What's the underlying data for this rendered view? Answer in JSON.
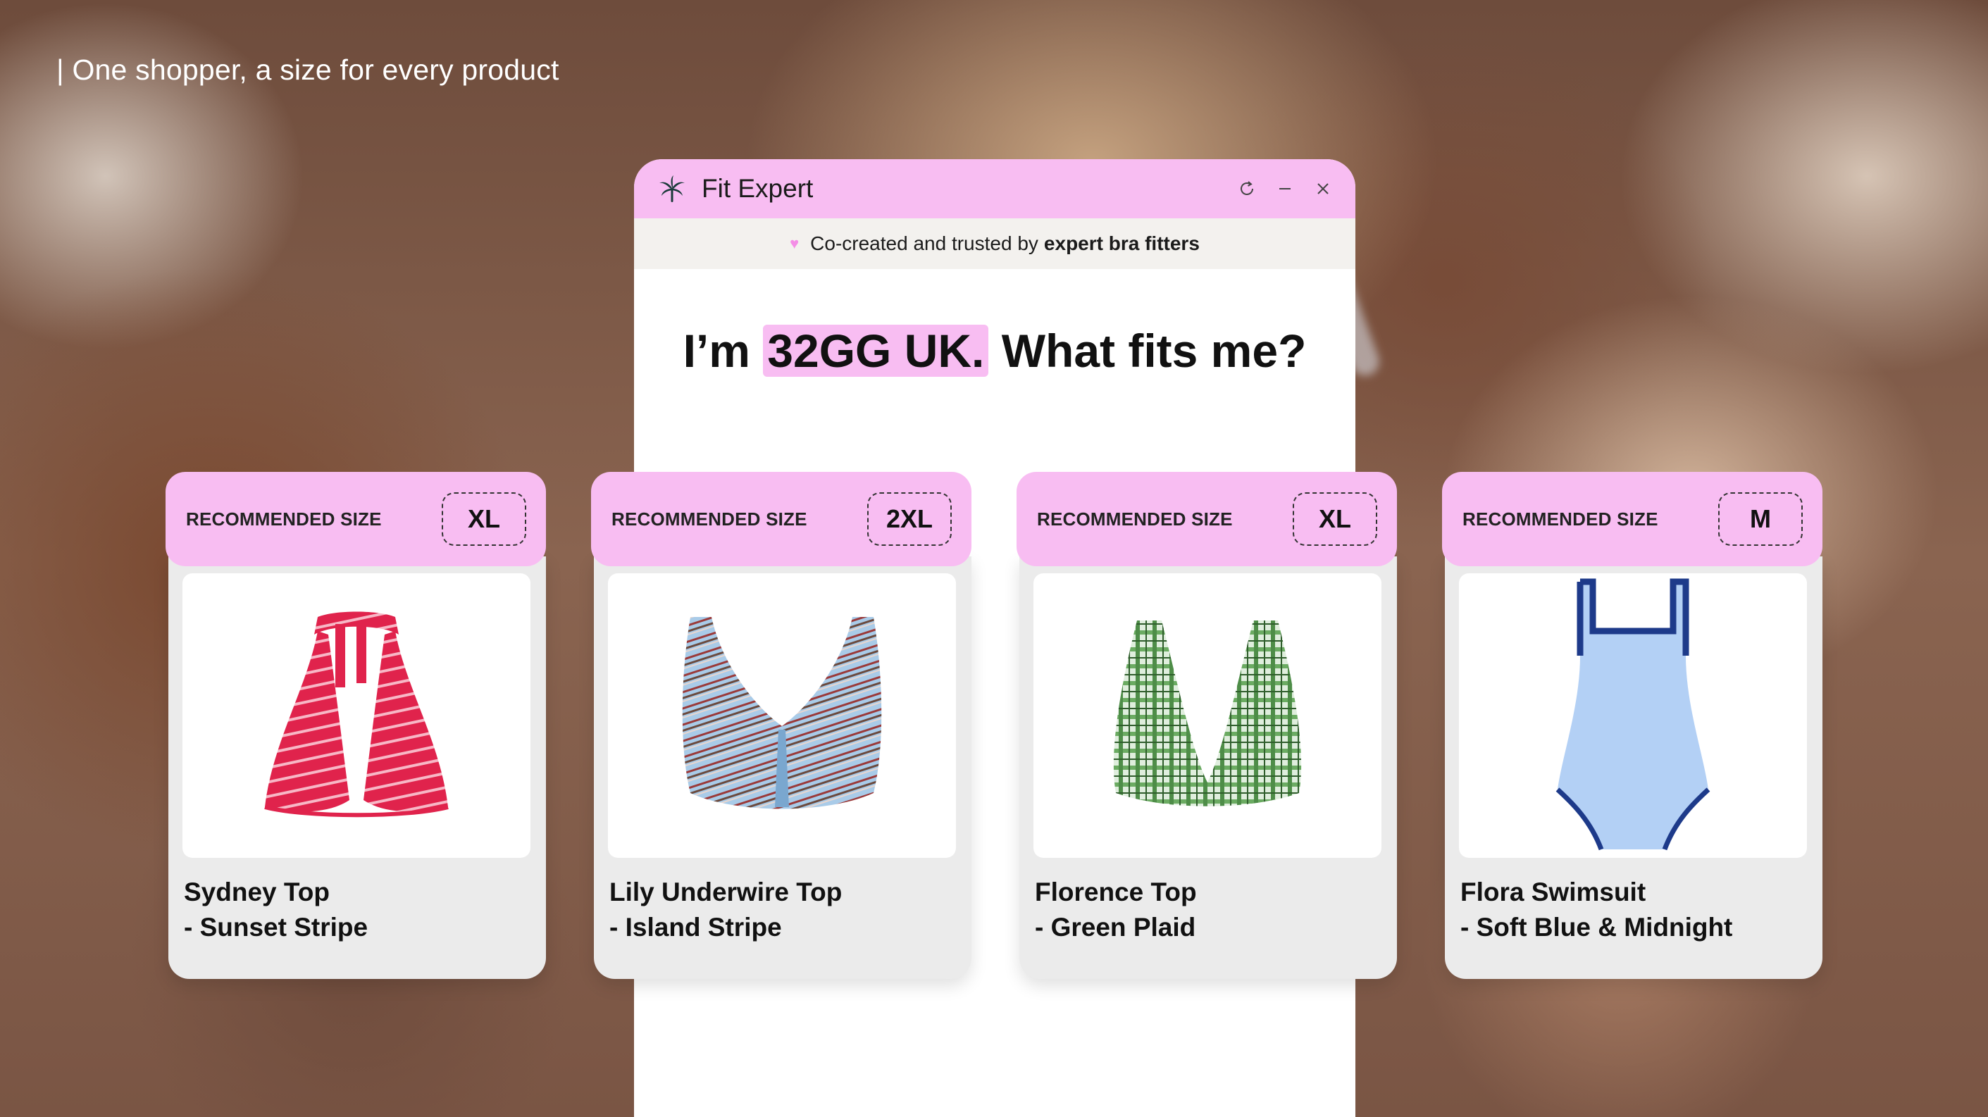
{
  "headline": "| One shopper, a size for every product",
  "widget": {
    "title": "Fit Expert",
    "banner_prefix": "Co-created and trusted by",
    "banner_bold": "expert bra fitters",
    "question_start": "I’m",
    "question_size": "32GG UK.",
    "question_end": "What fits me?"
  },
  "products": [
    {
      "rec_label": "RECOMMENDED SIZE",
      "size": "XL",
      "name_line1": "Sydney Top",
      "name_line2": "- Sunset Stripe"
    },
    {
      "rec_label": "RECOMMENDED SIZE",
      "size": "2XL",
      "name_line1": "Lily Underwire Top",
      "name_line2": "- Island Stripe"
    },
    {
      "rec_label": "RECOMMENDED SIZE",
      "size": "XL",
      "name_line1": "Florence Top",
      "name_line2": "- Green Plaid"
    },
    {
      "rec_label": "RECOMMENDED SIZE",
      "size": "M",
      "name_line1": "Flora Swimsuit",
      "name_line2": "- Soft Blue & Midnight"
    }
  ],
  "colors": {
    "accent_pink": "#f8bdf2",
    "banner_bg": "#f3f1ee",
    "card_bg": "#ebebeb"
  }
}
